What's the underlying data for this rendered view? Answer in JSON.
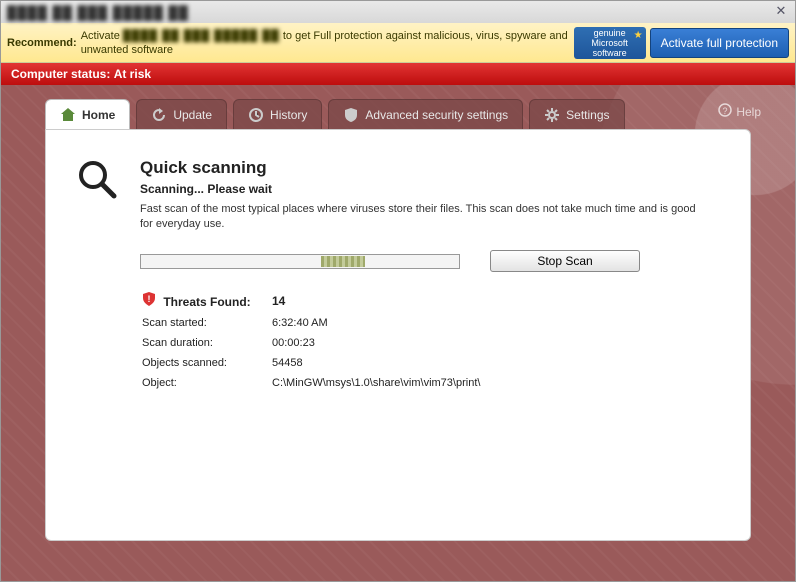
{
  "titlebar": {
    "title": "████ ██ ███ █████ ██"
  },
  "recommend": {
    "label": "Recommend:",
    "text_pre": "Activate ",
    "text_blur": "████ ██ ███ █████ ██",
    "text_post": " to get Full protection against malicious, virus, spyware and unwanted software",
    "genuine_line1": "genuine",
    "genuine_line2": "Microsoft",
    "genuine_line3": "software",
    "activate_btn": "Activate full protection"
  },
  "status": {
    "label": "Computer status:",
    "value": "At risk"
  },
  "tabs": {
    "home": "Home",
    "update": "Update",
    "history": "History",
    "advanced": "Advanced security settings",
    "settings": "Settings",
    "help": "Help"
  },
  "scan": {
    "title": "Quick scanning",
    "subtitle": "Scanning... Please wait",
    "desc": "Fast scan of the most typical places where viruses store their files. This scan does not take much time and is good for everyday use.",
    "stop_btn": "Stop Scan"
  },
  "stats": {
    "threats_label": "Threats Found:",
    "threats_value": "14",
    "started_label": "Scan started:",
    "started_value": "6:32:40 AM",
    "duration_label": "Scan duration:",
    "duration_value": "00:00:23",
    "objects_label": "Objects scanned:",
    "objects_value": "54458",
    "object_label": "Object:",
    "object_value": "C:\\MinGW\\msys\\1.0\\share\\vim\\vim73\\print\\"
  }
}
